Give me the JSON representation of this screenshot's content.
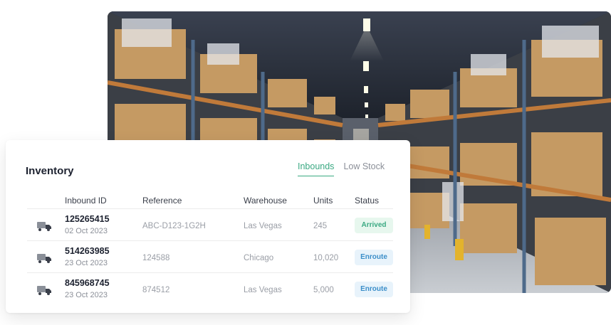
{
  "card": {
    "title": "Inventory"
  },
  "tabs": [
    {
      "label": "Inbounds",
      "active": true
    },
    {
      "label": "Low Stock",
      "active": false
    }
  ],
  "table": {
    "columns": [
      "Inbound ID",
      "Reference",
      "Warehouse",
      "Units",
      "Status"
    ],
    "rows": [
      {
        "id": "125265415",
        "date": "02 Oct 2023",
        "reference": "ABC-D123-1G2H",
        "warehouse": "Las Vegas",
        "units": "245",
        "status": "Arrived",
        "icon": "truck-icon"
      },
      {
        "id": "514263985",
        "date": "23 Oct 2023",
        "reference": "124588",
        "warehouse": "Chicago",
        "units": "10,020",
        "status": "Enroute",
        "icon": "truck-icon"
      },
      {
        "id": "845968745",
        "date": "23 Oct 2023",
        "reference": "874512",
        "warehouse": "Las Vegas",
        "units": "5,000",
        "status": "Enroute",
        "icon": "truck-icon"
      }
    ]
  },
  "colors": {
    "accent": "#3aa982",
    "arrived_bg": "#e7f7ee",
    "enroute_text": "#3b8ec9",
    "enroute_bg": "#e8f3fb"
  },
  "photo": {
    "subject": "warehouse-aisle-illustration"
  }
}
